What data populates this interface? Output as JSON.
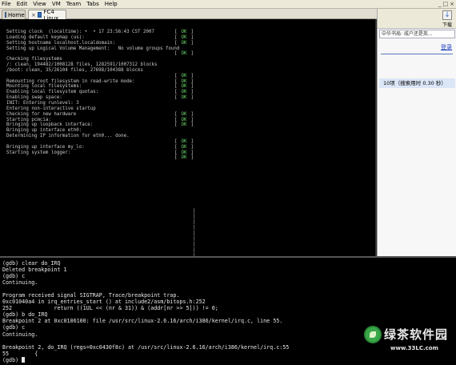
{
  "menu": [
    "File",
    "Edit",
    "View",
    "VM",
    "Team",
    "Tabs",
    "Help"
  ],
  "window_controls": [
    "_",
    "□",
    "×"
  ],
  "tabs": [
    {
      "label": "Home",
      "close": "×"
    },
    {
      "label": "FC4 Linux",
      "close": "×"
    }
  ],
  "console": {
    "lines": [
      {
        "text": "Setting clock  (localtime): •  • 17 23:56:43 CST 2007",
        "ok": "OK"
      },
      {
        "text": "Loading default keymap (us):",
        "ok": "OK"
      },
      {
        "text": "Setting hostname localhost.localdomain:",
        "ok": "OK"
      },
      {
        "text": "Setting up Logical Volume Management:   No volume groups found",
        "ok": ""
      },
      {
        "text": "",
        "ok": "OK"
      },
      {
        "text": "Checking filesystems",
        "ok": ""
      },
      {
        "text": "/: clean, 194482/1008128 files, 1282591/1007312 blocks",
        "ok": ""
      },
      {
        "text": "/boot: clean, 35/26104 files, 27698/104388 blocks",
        "ok": ""
      },
      {
        "text": "",
        "ok": "OK"
      },
      {
        "text": "Remounting root filesystem in read-write mode:",
        "ok": "OK"
      },
      {
        "text": "Mounting local filesystems:",
        "ok": "OK"
      },
      {
        "text": "Enabling local filesystem quotas:",
        "ok": "OK"
      },
      {
        "text": "Enabling swap space:",
        "ok": "OK"
      },
      {
        "text": "INIT: Entering runlevel: 3",
        "ok": ""
      },
      {
        "text": "Entering non-interactive startup",
        "ok": ""
      },
      {
        "text": "Checking for new hardware",
        "ok": "OK"
      },
      {
        "text": "Starting pcmcia:",
        "ok": "OK"
      },
      {
        "text": "Bringing up loopback interface:",
        "ok": "OK"
      },
      {
        "text": "Bringing up interface eth0:",
        "ok": ""
      },
      {
        "text": "Determining IP information for eth0... done.",
        "ok": ""
      },
      {
        "text": "",
        "ok": "OK"
      },
      {
        "text": "Bringing up interface my_lo:",
        "ok": "OK"
      },
      {
        "text": "Starting system logger:",
        "ok": "OK"
      },
      {
        "text": "",
        "ok": "OK"
      }
    ],
    "ok_open": "[",
    "ok_close": "]",
    "pipe_char": "|",
    "pipe_count": 14
  },
  "right_panel": {
    "search_text": "中华书局: 戚户还是英...",
    "download_label": "下载",
    "login_label": "登录",
    "result_stat": "10项（搜索用时 0.30 秒）"
  },
  "gdb": {
    "lines": [
      "(gdb) clear do_IRQ",
      "Deleted breakpoint 1",
      "(gdb) c",
      "Continuing.",
      "",
      "Program received signal SIGTRAP, Trace/breakpoint trap.",
      "0xc01040a4 in irq_entries_start () at include2/asm/bitops.h:252",
      "252             return ((1UL << (nr & 31)) & (addr[nr >> 5])) != 0;",
      "(gdb) b do_IRQ",
      "Breakpoint 2 at 0xc0106100: file /usr/src/linux-2.6.16/arch/i386/kernel/irq.c, line 55.",
      "(gdb) c",
      "Continuing.",
      "",
      "Breakpoint 2, do_IRQ (regs=0xc0430f8c) at /usr/src/linux-2.6.16/arch/i386/kernel/irq.c:55",
      "55        {"
    ],
    "prompt": "(gdb) "
  },
  "watermark": {
    "title": "绿茶软件园",
    "url": "www.33LC.com"
  }
}
